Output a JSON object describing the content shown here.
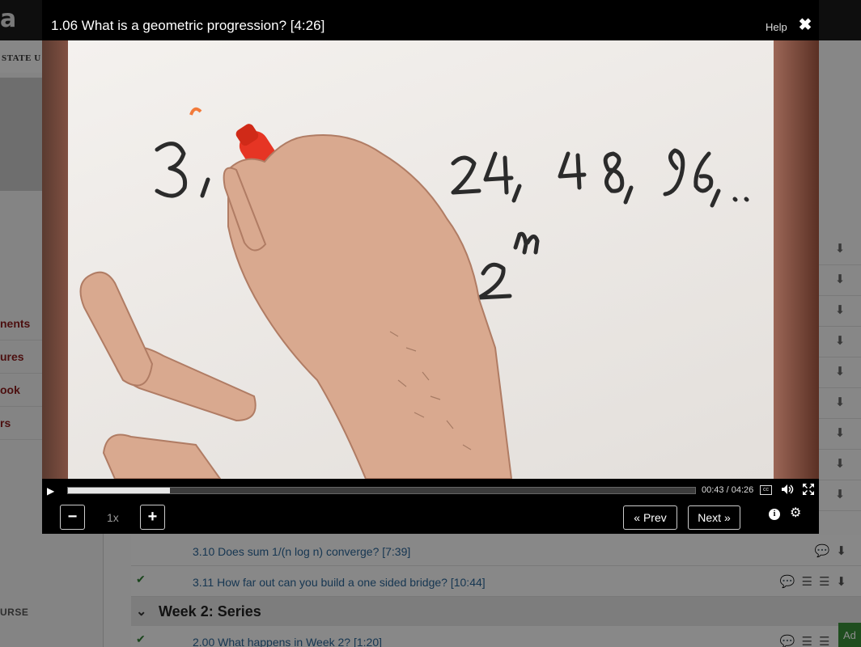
{
  "modal": {
    "title": "1.06 What is a geometric progression? [4:26]",
    "help_label": "Help",
    "close_icon": "✖"
  },
  "video": {
    "progress_fraction": 0.163,
    "current_time": "00:43",
    "duration": "04:26",
    "time_separator": " / ",
    "cc_label": "cc"
  },
  "controls": {
    "speed_decrease": "−",
    "speed_value": "1x",
    "speed_increase": "+",
    "prev_label": "« Prev",
    "next_label": "Next »",
    "info_label": "i",
    "settings_icon": "⚙"
  },
  "background": {
    "logo": "a",
    "university": "STATE U",
    "nav_items": [
      "nents",
      "ures",
      "ook",
      "rs"
    ],
    "course_label": "URSE",
    "lectures": [
      {
        "title": "3.10 Does sum 1/(n log n) converge? [7:39]",
        "checked": false
      },
      {
        "title": "3.11 How far out can you build a one sided bridge? [10:44]",
        "checked": true
      }
    ],
    "week_title": "Week 2: Series",
    "next_lecture": "2.00 What happens in Week 2? [1:20]",
    "add_label": "Ad"
  }
}
